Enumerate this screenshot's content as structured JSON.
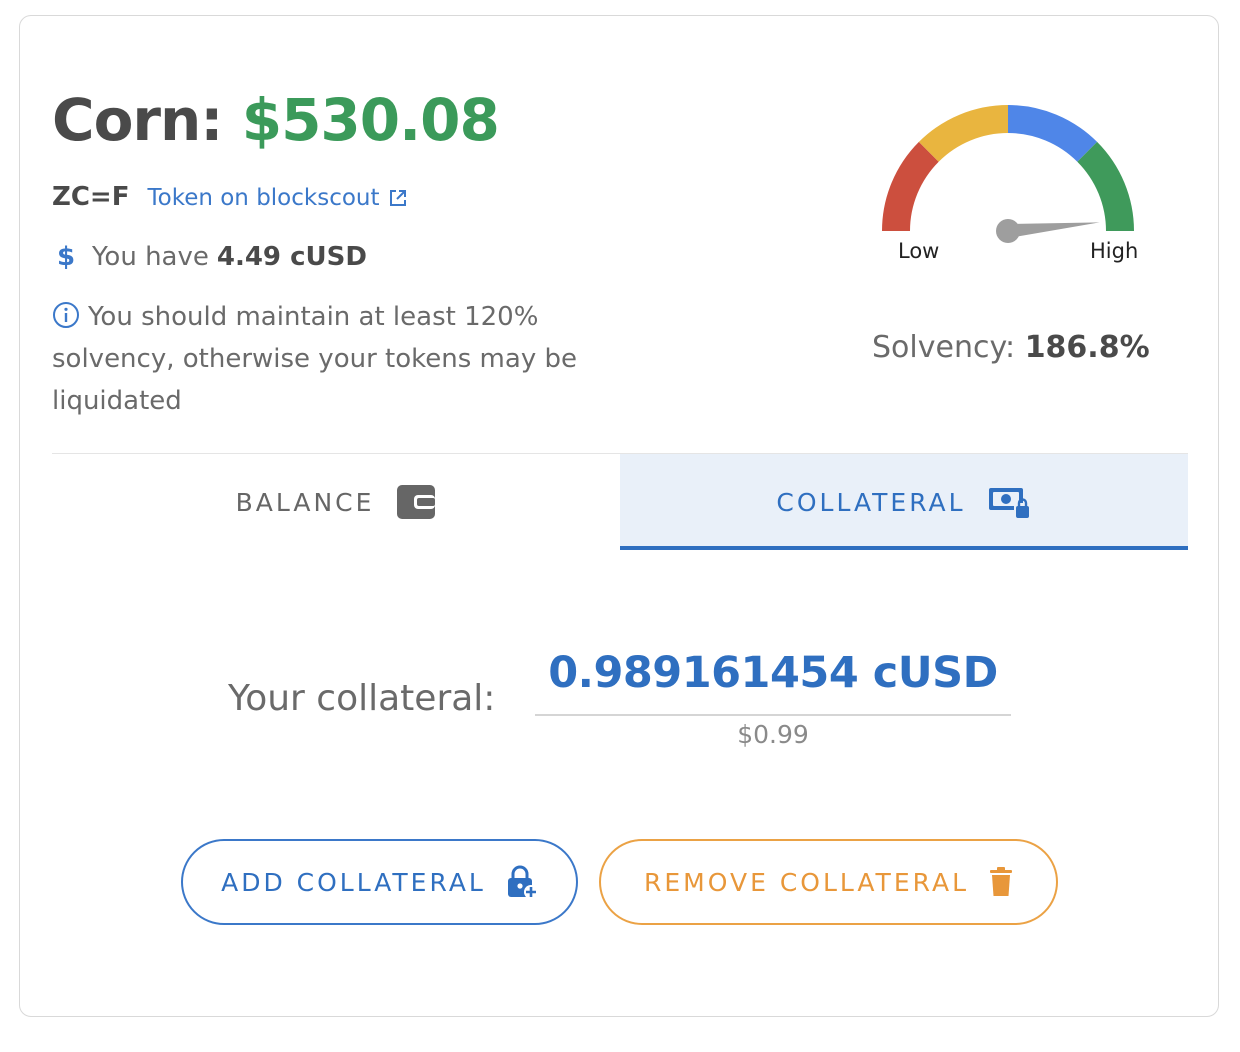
{
  "header": {
    "name": "Corn:",
    "price": "$530.08",
    "ticker": "ZC=F",
    "scout_link": "Token on blockscout",
    "have_prefix": "You have",
    "have_amount": "4.49 cUSD",
    "warning": "You should maintain at least 120% solvency, otherwise your tokens may be liquidated"
  },
  "gauge": {
    "low_label": "Low",
    "high_label": "High",
    "level": 0.97,
    "colors": [
      "#cc4f3e",
      "#e9b53f",
      "#4f86e8",
      "#3f9a5b"
    ],
    "needle_color": "#9e9e9e"
  },
  "solvency": {
    "label": "Solvency:",
    "value": "186.8%"
  },
  "tabs": [
    {
      "label": "BALANCE",
      "active": false
    },
    {
      "label": "COLLATERAL",
      "active": true
    }
  ],
  "collateral": {
    "label": "Your collateral:",
    "amount": "0.989161454 cUSD",
    "usd": "$0.99"
  },
  "buttons": {
    "add": "ADD COLLATERAL",
    "remove": "REMOVE COLLATERAL"
  },
  "colors": {
    "accent": "#2f6fc0",
    "price_green": "#3b9a5a",
    "remove_orange": "#e8973a"
  }
}
